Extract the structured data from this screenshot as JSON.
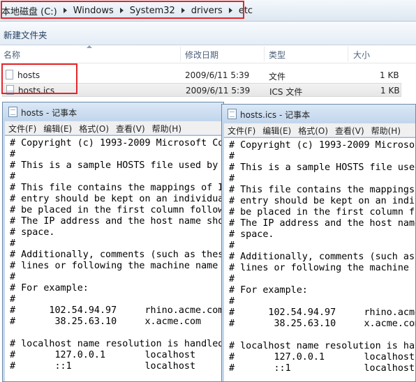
{
  "address_bar": {
    "path": [
      "本地磁盘 (C:)",
      "Windows",
      "System32",
      "drivers",
      "etc"
    ]
  },
  "toolbar": {
    "new_folder": "新建文件夹"
  },
  "columns": {
    "name": "名称",
    "modified": "修改日期",
    "type": "类型",
    "size": "大小"
  },
  "files": [
    {
      "name": "hosts",
      "modified": "2009/6/11 5:39",
      "type": "文件",
      "size": "1 KB"
    },
    {
      "name": "hosts.ics",
      "modified": "2009/6/11 5:39",
      "type": "ICS 文件",
      "size": "1 KB"
    }
  ],
  "notepad_menu": [
    "文件(F)",
    "编辑(E)",
    "格式(O)",
    "查看(V)",
    "帮助(H)"
  ],
  "notepad_left": {
    "title": "hosts - 记事本",
    "lines": [
      "# Copyright (c) 1993-2009 Microsoft Co",
      "#",
      "# This is a sample HOSTS file used by",
      "#",
      "# This file contains the mappings of I",
      "# entry should be kept on an individua",
      "# be placed in the first column follow",
      "# The IP address and the host name sho",
      "# space.",
      "#",
      "# Additionally, comments (such as thes",
      "# lines or following the machine name",
      "#",
      "# For example:",
      "#",
      "#      102.54.94.97     rhino.acme.com",
      "#       38.25.63.10     x.acme.com",
      "",
      "# localhost name resolution is handled",
      "#       127.0.0.1       localhost",
      "#       ::1             localhost"
    ]
  },
  "notepad_right": {
    "title": "hosts.ics - 记事本",
    "lines": [
      "# Copyright (c) 1993-2009 Microso",
      "#",
      "# This is a sample HOSTS file used",
      "#",
      "# This file contains the mappings",
      "# entry should be kept on an indiv",
      "# be placed in the first column fo",
      "# The IP address and the host name",
      "# space.",
      "#",
      "# Additionally, comments (such as",
      "# lines or following the machine n",
      "#",
      "# For example:",
      "#",
      "#      102.54.94.97     rhino.acme",
      "#       38.25.63.10     x.acme.com",
      "",
      "# localhost name resolution is han",
      "#       127.0.0.1       localhost",
      "#       ::1             localhost"
    ]
  },
  "colors": {
    "highlight_box": "#e3262a",
    "window_frame": "#c4d7ec"
  }
}
